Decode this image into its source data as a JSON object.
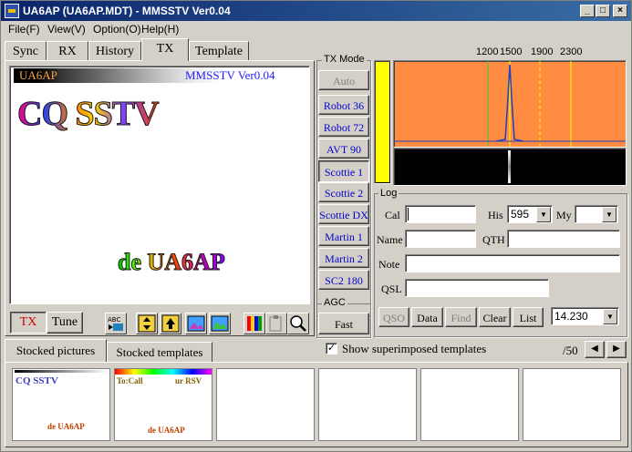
{
  "window": {
    "title": "UA6AP (UA6AP.MDT) - MMSSTV Ver0.04"
  },
  "menu": [
    {
      "label": "File(F)"
    },
    {
      "label": "View(V)"
    },
    {
      "label": "Option(O)"
    },
    {
      "label": "Help(H)"
    }
  ],
  "tabs": [
    {
      "label": "Sync"
    },
    {
      "label": "RX"
    },
    {
      "label": "History"
    },
    {
      "label": "TX"
    },
    {
      "label": "Template"
    }
  ],
  "preview": {
    "callsign": "UA6AP",
    "version": "MMSSTV Ver0.04",
    "cq_text": "CQ SSTV",
    "de_text": "de UA6AP"
  },
  "tx_mode": {
    "title": "TX Mode",
    "buttons": [
      {
        "label": "Auto"
      },
      {
        "label": "Robot 36"
      },
      {
        "label": "Robot 72"
      },
      {
        "label": "AVT 90"
      },
      {
        "label": "Scottie 1"
      },
      {
        "label": "Scottie 2"
      },
      {
        "label": "Scottie DX"
      },
      {
        "label": "Martin 1"
      },
      {
        "label": "Martin 2"
      },
      {
        "label": "SC2 180"
      }
    ]
  },
  "agc": {
    "title": "AGC",
    "value": "Fast"
  },
  "spectrum": {
    "ticks": [
      "1200",
      "1500",
      "1900",
      "2300"
    ]
  },
  "log": {
    "title": "Log",
    "cal_label": "Cal",
    "cal_value": "",
    "his_label": "His",
    "his_value": "595",
    "my_label": "My",
    "my_value": "",
    "name_label": "Name",
    "name_value": "",
    "qth_label": "QTH",
    "qth_value": "",
    "note_label": "Note",
    "note_value": "",
    "qsl_label": "QSL",
    "qsl_value": "",
    "buttons": [
      {
        "label": "QSO"
      },
      {
        "label": "Data"
      },
      {
        "label": "Find"
      },
      {
        "label": "Clear"
      },
      {
        "label": "List"
      }
    ],
    "freq_value": "14.230"
  },
  "tx_controls": {
    "tx_label": "TX",
    "tune_label": "Tune"
  },
  "stock": {
    "tab_pictures": "Stocked pictures",
    "tab_templates": "Stocked templates",
    "show_label": "Show superimposed templates",
    "counter": "/50",
    "thumb1": {
      "cq": "CQ SSTV",
      "de": "de UA6AP"
    },
    "thumb2": {
      "to": "To:Call",
      "rsv": "ur RSV",
      "de": "de UA6AP"
    }
  },
  "colors": {
    "titlebar": "#0a246a",
    "spectrum_bg": "#ff8c40",
    "level_bar": "#ffff00",
    "mode_text": "#0000cc",
    "tx_red": "#cc0000"
  }
}
